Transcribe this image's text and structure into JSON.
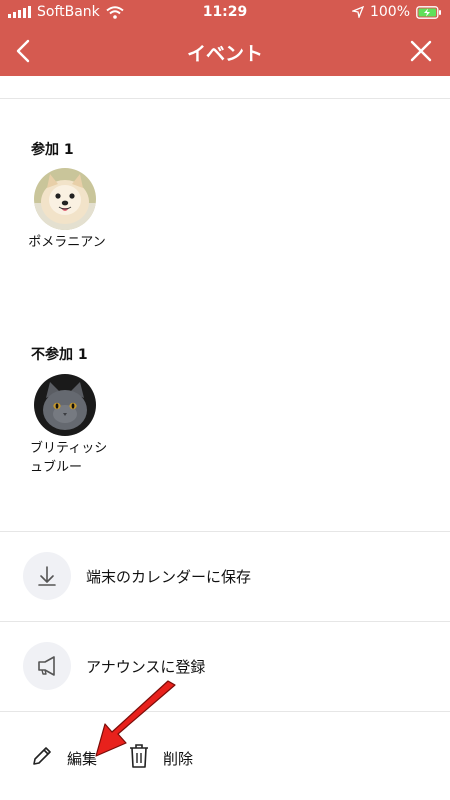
{
  "status_bar": {
    "carrier": "SoftBank",
    "time": "11:29",
    "battery": "100%"
  },
  "nav": {
    "title": "イベント"
  },
  "attending": {
    "label": "参加 1",
    "members": [
      {
        "name": "ポメラニアン",
        "avatar": "pomeranian-dog-photo"
      }
    ]
  },
  "not_attending": {
    "label": "不参加 1",
    "members": [
      {
        "name": "ブリティッシュブルー",
        "avatar": "british-blue-cat-photo"
      }
    ]
  },
  "actions": [
    {
      "label": "端末のカレンダーに保存",
      "icon": "download-icon"
    },
    {
      "label": "アナウンスに登録",
      "icon": "megaphone-icon"
    }
  ],
  "bottom": {
    "edit_label": "編集",
    "delete_label": "削除"
  },
  "colors": {
    "header": "#d55a50",
    "annotation_arrow": "#e8211c"
  }
}
